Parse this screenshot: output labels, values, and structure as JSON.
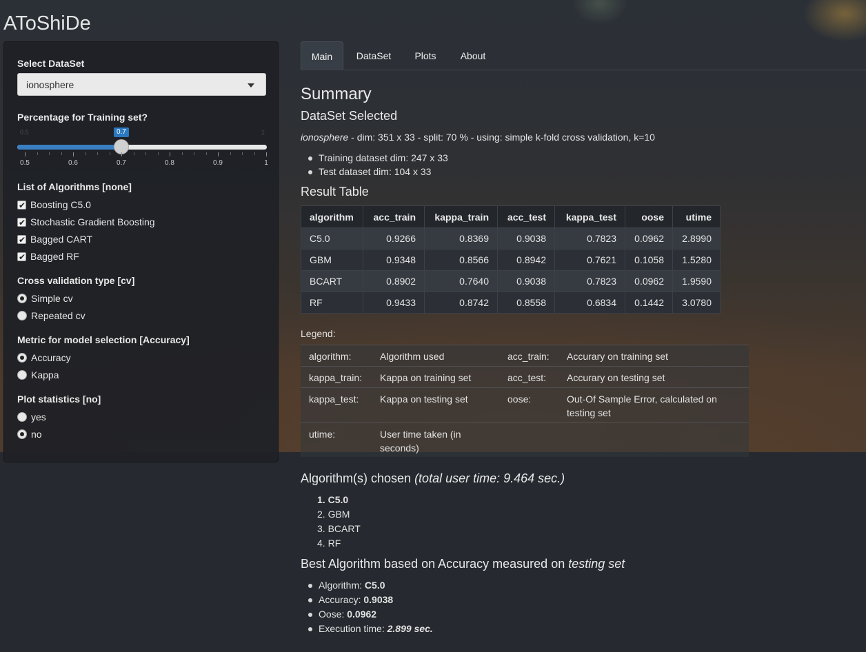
{
  "app": {
    "title": "AToShiDe"
  },
  "sidebar": {
    "dataset_label": "Select DataSet",
    "dataset_value": "ionosphere",
    "slider": {
      "label": "Percentage for Training set?",
      "value": 0.7,
      "value_text": "0.7",
      "min_text": "0.5",
      "max_text": "1",
      "ticks": [
        "0.5",
        "0.6",
        "0.7",
        "0.8",
        "0.9",
        "1"
      ]
    },
    "algorithms_label": "List of Algorithms [none]",
    "algorithms": [
      {
        "label": "Boosting C5.0",
        "checked": true
      },
      {
        "label": "Stochastic Gradient Boosting",
        "checked": true
      },
      {
        "label": "Bagged CART",
        "checked": true
      },
      {
        "label": "Bagged RF",
        "checked": true
      }
    ],
    "cv_label": "Cross validation type [cv]",
    "cv_options": [
      {
        "label": "Simple cv",
        "selected": true
      },
      {
        "label": "Repeated cv",
        "selected": false
      }
    ],
    "metric_label": "Metric for model selection [Accuracy]",
    "metric_options": [
      {
        "label": "Accuracy",
        "selected": true
      },
      {
        "label": "Kappa",
        "selected": false
      }
    ],
    "plot_label": "Plot statistics [no]",
    "plot_options": [
      {
        "label": "yes",
        "selected": false
      },
      {
        "label": "no",
        "selected": true
      }
    ]
  },
  "tabs": [
    "Main",
    "DataSet",
    "Plots",
    "About"
  ],
  "active_tab": "Main",
  "main": {
    "summary_title": "Summary",
    "dataset_title": "DataSet Selected",
    "dataset_name": "ionosphere",
    "dataset_desc": " - dim: 351 x 33 - split: 70 % - using: simple k-fold cross validation, k=10",
    "dims": [
      "Training dataset dim: 247 x 33",
      "Test dataset dim: 104 x 33"
    ],
    "result_title": "Result Table",
    "table": {
      "headers": [
        "algorithm",
        "acc_train",
        "kappa_train",
        "acc_test",
        "kappa_test",
        "oose",
        "utime"
      ],
      "rows": [
        [
          "C5.0",
          "0.9266",
          "0.8369",
          "0.9038",
          "0.7823",
          "0.0962",
          "2.8990"
        ],
        [
          "GBM",
          "0.9348",
          "0.8566",
          "0.8942",
          "0.7621",
          "0.1058",
          "1.5280"
        ],
        [
          "BCART",
          "0.8902",
          "0.7640",
          "0.9038",
          "0.7823",
          "0.0962",
          "1.9590"
        ],
        [
          "RF",
          "0.9433",
          "0.8742",
          "0.8558",
          "0.6834",
          "0.1442",
          "3.0780"
        ]
      ]
    },
    "legend_title": "Legend:",
    "legend": [
      [
        "algorithm:",
        "Algorithm used",
        "acc_train:",
        "Accurary on training set"
      ],
      [
        "kappa_train:",
        "Kappa on training set",
        "acc_test:",
        "Accurary on testing set"
      ],
      [
        "kappa_test:",
        "Kappa on testing set",
        "oose:",
        "Out-Of Sample Error, calculated on testing set"
      ],
      [
        "utime:",
        "User time taken (in seconds)",
        "",
        ""
      ]
    ],
    "chosen_title": "Algorithm(s) chosen ",
    "chosen_time": "(total user time: 9.464 sec.)",
    "chosen": [
      "C5.0",
      "GBM",
      "BCART",
      "RF"
    ],
    "best_title": "Best Algorithm based on Accuracy measured on ",
    "best_title_em": "testing set",
    "best": {
      "algorithm_label": "Algorithm: ",
      "algorithm_value": "C5.0",
      "accuracy_label": "Accuracy: ",
      "accuracy_value": "0.9038",
      "oose_label": "Oose: ",
      "oose_value": "0.0962",
      "time_label": "Execution time: ",
      "time_value": "2.899 sec."
    }
  }
}
